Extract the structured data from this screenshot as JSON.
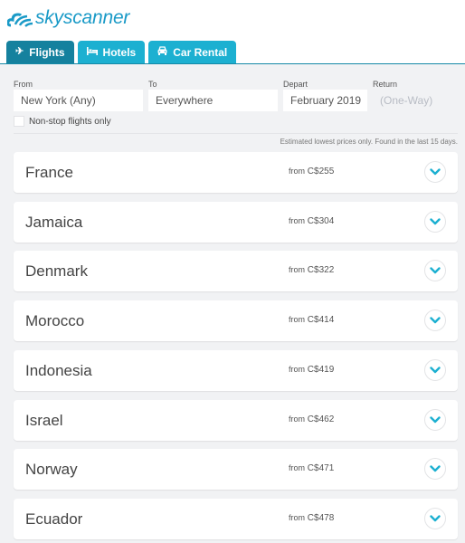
{
  "brand": {
    "name": "skyscanner",
    "color": "#1a9ac7"
  },
  "tabs": [
    {
      "label": "Flights",
      "icon": "plane-icon",
      "active": true
    },
    {
      "label": "Hotels",
      "icon": "bed-icon",
      "active": false
    },
    {
      "label": "Car Rental",
      "icon": "car-icon",
      "active": false
    }
  ],
  "search": {
    "from": {
      "label": "From",
      "value": "New York (Any)"
    },
    "to": {
      "label": "To",
      "value": "Everywhere"
    },
    "depart": {
      "label": "Depart",
      "value": "February 2019"
    },
    "return": {
      "label": "Return",
      "value": "(One-Way)"
    },
    "nonstop_label": "Non-stop flights only",
    "nonstop_checked": false
  },
  "note": "Estimated lowest prices only. Found in the last 15 days.",
  "results": [
    {
      "country": "France",
      "from": "from",
      "price": "C$255"
    },
    {
      "country": "Jamaica",
      "from": "from",
      "price": "C$304"
    },
    {
      "country": "Denmark",
      "from": "from",
      "price": "C$322"
    },
    {
      "country": "Morocco",
      "from": "from",
      "price": "C$414"
    },
    {
      "country": "Indonesia",
      "from": "from",
      "price": "C$419"
    },
    {
      "country": "Israel",
      "from": "from",
      "price": "C$462"
    },
    {
      "country": "Norway",
      "from": "from",
      "price": "C$471"
    },
    {
      "country": "Ecuador",
      "from": "from",
      "price": "C$478"
    }
  ],
  "colors": {
    "tab": "#1cb0d1",
    "tab_active": "#15819e",
    "chevron": "#1cb0d1"
  }
}
